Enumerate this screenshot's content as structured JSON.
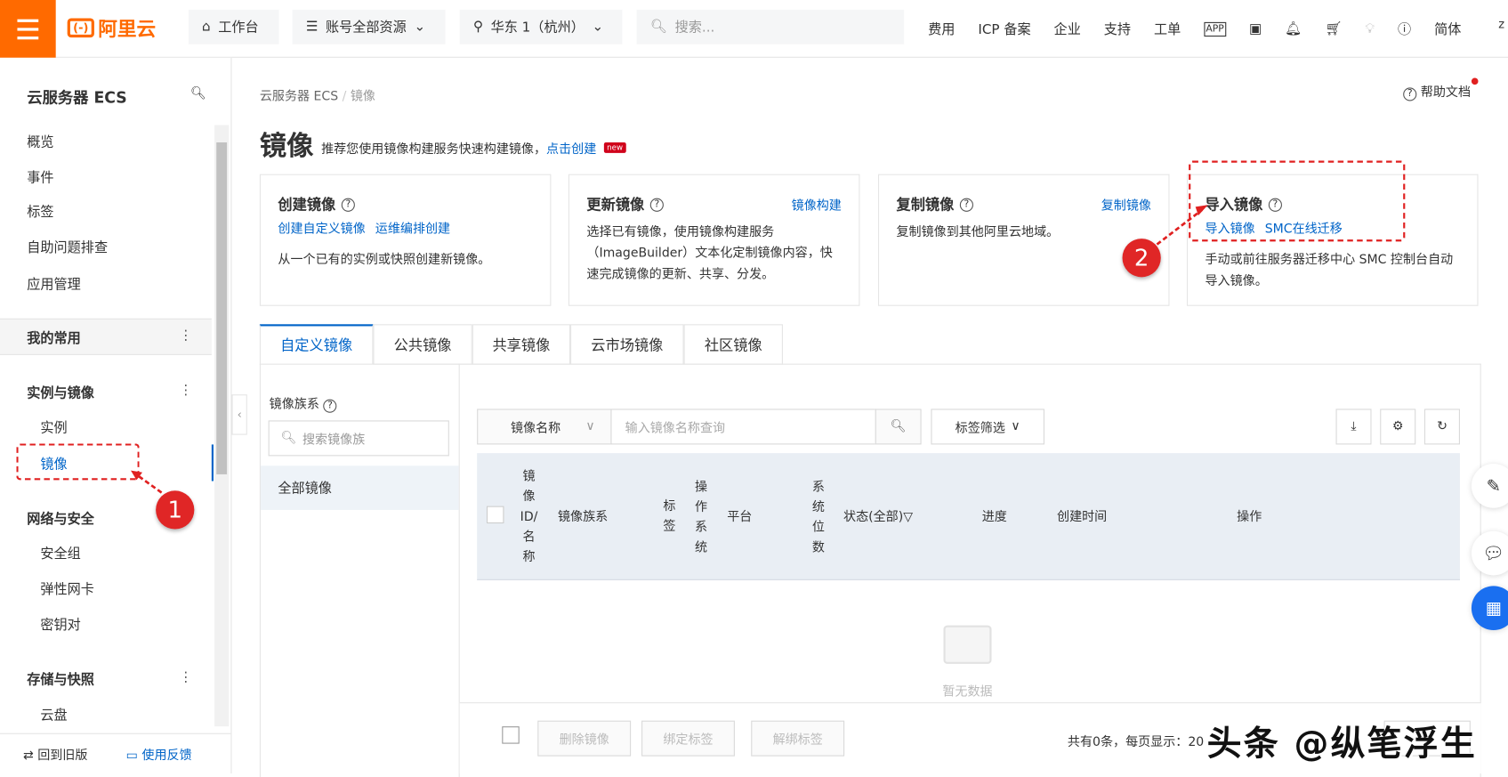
{
  "topbar": {
    "logo": "阿里云",
    "workbench": "工作台",
    "account": "账号全部资源",
    "region": "华东 1（杭州）",
    "search_placeholder": "搜索...",
    "links": [
      "费用",
      "ICP 备案",
      "企业",
      "支持",
      "工单"
    ],
    "icons": [
      "app-icon",
      "terminal-icon",
      "bell-icon",
      "cart-icon",
      "bulb-icon",
      "help-icon"
    ],
    "lang": "简体",
    "user": "z"
  },
  "sidebar": {
    "title": "云服务器 ECS",
    "items": [
      "概览",
      "事件",
      "标签",
      "自助问题排查",
      "应用管理"
    ],
    "fav": "我的常用",
    "groups": [
      {
        "label": "实例与镜像",
        "items": [
          "实例",
          "镜像"
        ]
      },
      {
        "label": "网络与安全",
        "items": [
          "安全组",
          "弹性网卡",
          "密钥对"
        ]
      },
      {
        "label": "存储与快照",
        "items": [
          "云盘"
        ]
      }
    ],
    "old": "回到旧版",
    "feedback": "使用反馈"
  },
  "main": {
    "breadcrumb": [
      "云服务器 ECS",
      "镜像"
    ],
    "help": "帮助文档",
    "title": "镜像",
    "subtitle": "推荐您使用镜像构建服务快速构建镜像，",
    "create_link": "点击创建",
    "new_badge": "new",
    "cards": [
      {
        "title": "创建镜像",
        "links": [
          "创建自定义镜像",
          "运维编排创建"
        ],
        "desc": "从一个已有的实例或快照创建新镜像。"
      },
      {
        "title": "更新镜像",
        "right": "镜像构建",
        "desc": "选择已有镜像，使用镜像构建服务（ImageBuilder）文本化定制镜像内容，快速完成镜像的更新、共享、分发。"
      },
      {
        "title": "复制镜像",
        "right": "复制镜像",
        "desc": "复制镜像到其他阿里云地域。"
      },
      {
        "title": "导入镜像",
        "links": [
          "导入镜像",
          "SMC在线迁移"
        ],
        "desc": "手动或前往服务器迁移中心 SMC 控制台自动导入镜像。"
      }
    ],
    "tabs": [
      "自定义镜像",
      "公共镜像",
      "共享镜像",
      "云市场镜像",
      "社区镜像"
    ],
    "family": {
      "label": "镜像族系",
      "search_placeholder": "搜索镜像族",
      "all": "全部镜像"
    },
    "toolbar": {
      "select": "镜像名称",
      "input_placeholder": "输入镜像名称查询",
      "tag_filter": "标签筛选"
    },
    "columns": [
      "镜像ID/名称",
      "镜像族系",
      "标签",
      "操作系统",
      "平台",
      "系统位数",
      "状态(全部)",
      "进度",
      "创建时间",
      "操作"
    ],
    "empty": "暂无数据",
    "footer": {
      "buttons": [
        "删除镜像",
        "绑定标签",
        "解绑标签"
      ],
      "pagination": "共有0条，每页显示：20"
    }
  },
  "annotations": {
    "step1": "1",
    "step2": "2",
    "accent": "#e02020"
  },
  "watermark": "头条 @纵笔浮生",
  "colors": {
    "brand": "#ff6a00",
    "link": "#0064c8"
  }
}
